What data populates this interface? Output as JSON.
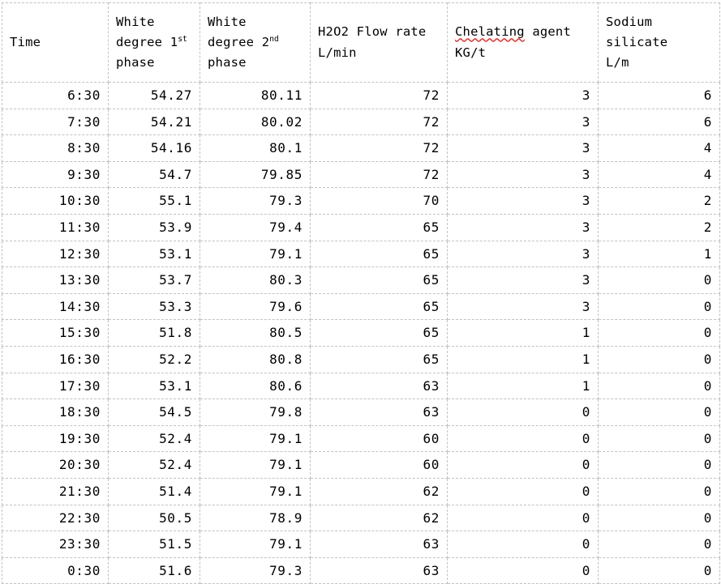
{
  "table": {
    "columns": [
      {
        "key": "time",
        "label": "Time",
        "label_lines": [
          "Time"
        ],
        "unit": ""
      },
      {
        "key": "wd1",
        "label": "White degree 1st phase",
        "label_lines": [
          "White",
          "degree 1st",
          "phase"
        ],
        "unit": ""
      },
      {
        "key": "wd2",
        "label": "White degree 2nd phase",
        "label_lines": [
          "White",
          "degree 2nd",
          "phase"
        ],
        "unit": ""
      },
      {
        "key": "h2o2",
        "label": "H2O2 Flow rate L/min",
        "label_lines": [
          "H2O2 Flow rate",
          "L/min"
        ],
        "unit": "L/min"
      },
      {
        "key": "chelating",
        "label": "Chelating agent KG/t",
        "label_lines": [
          "Chelating agent",
          "KG/t"
        ],
        "unit": "KG/t"
      },
      {
        "key": "silicate",
        "label": "Sodium silicate L/m",
        "label_lines": [
          "Sodium",
          "silicate",
          "L/m"
        ],
        "unit": "L/m"
      }
    ],
    "header": {
      "time": "Time",
      "white_degree_1st": {
        "line1": "White",
        "line2_pre": "degree 1",
        "line2_sup": "st",
        "line3": "phase"
      },
      "white_degree_2nd": {
        "line1": "White",
        "line2_pre": "degree 2",
        "line2_sup": "nd",
        "line3": "phase"
      },
      "h2o2": {
        "line1": "H2O2 Flow rate",
        "line2": "L/min"
      },
      "chelating": {
        "line1_misspelled": "Chelating",
        "line1_rest": " agent",
        "line2": "KG/t"
      },
      "sodium_silicate": {
        "line1": "Sodium",
        "line2": "silicate",
        "line3": "L/m"
      }
    },
    "rows": [
      {
        "time": "6:30",
        "wd1": "54.27",
        "wd2": "80.11",
        "h2o2": "72",
        "chelating": "3",
        "silicate": "6"
      },
      {
        "time": "7:30",
        "wd1": "54.21",
        "wd2": "80.02",
        "h2o2": "72",
        "chelating": "3",
        "silicate": "6"
      },
      {
        "time": "8:30",
        "wd1": "54.16",
        "wd2": "80.1",
        "h2o2": "72",
        "chelating": "3",
        "silicate": "4"
      },
      {
        "time": "9:30",
        "wd1": "54.7",
        "wd2": "79.85",
        "h2o2": "72",
        "chelating": "3",
        "silicate": "4"
      },
      {
        "time": "10:30",
        "wd1": "55.1",
        "wd2": "79.3",
        "h2o2": "70",
        "chelating": "3",
        "silicate": "2"
      },
      {
        "time": "11:30",
        "wd1": "53.9",
        "wd2": "79.4",
        "h2o2": "65",
        "chelating": "3",
        "silicate": "2"
      },
      {
        "time": "12:30",
        "wd1": "53.1",
        "wd2": "79.1",
        "h2o2": "65",
        "chelating": "3",
        "silicate": "1"
      },
      {
        "time": "13:30",
        "wd1": "53.7",
        "wd2": "80.3",
        "h2o2": "65",
        "chelating": "3",
        "silicate": "0"
      },
      {
        "time": "14:30",
        "wd1": "53.3",
        "wd2": "79.6",
        "h2o2": "65",
        "chelating": "3",
        "silicate": "0"
      },
      {
        "time": "15:30",
        "wd1": "51.8",
        "wd2": "80.5",
        "h2o2": "65",
        "chelating": "1",
        "silicate": "0"
      },
      {
        "time": "16:30",
        "wd1": "52.2",
        "wd2": "80.8",
        "h2o2": "65",
        "chelating": "1",
        "silicate": "0"
      },
      {
        "time": "17:30",
        "wd1": "53.1",
        "wd2": "80.6",
        "h2o2": "63",
        "chelating": "1",
        "silicate": "0"
      },
      {
        "time": "18:30",
        "wd1": "54.5",
        "wd2": "79.8",
        "h2o2": "63",
        "chelating": "0",
        "silicate": "0"
      },
      {
        "time": "19:30",
        "wd1": "52.4",
        "wd2": "79.1",
        "h2o2": "60",
        "chelating": "0",
        "silicate": "0"
      },
      {
        "time": "20:30",
        "wd1": "52.4",
        "wd2": "79.1",
        "h2o2": "60",
        "chelating": "0",
        "silicate": "0"
      },
      {
        "time": "21:30",
        "wd1": "51.4",
        "wd2": "79.1",
        "h2o2": "62",
        "chelating": "0",
        "silicate": "0"
      },
      {
        "time": "22:30",
        "wd1": "50.5",
        "wd2": "78.9",
        "h2o2": "62",
        "chelating": "0",
        "silicate": "0"
      },
      {
        "time": "23:30",
        "wd1": "51.5",
        "wd2": "79.1",
        "h2o2": "63",
        "chelating": "0",
        "silicate": "0"
      },
      {
        "time": "0:30",
        "wd1": "51.6",
        "wd2": "79.3",
        "h2o2": "63",
        "chelating": "0",
        "silicate": "0"
      }
    ]
  },
  "chart_data": {
    "type": "table",
    "title": "",
    "columns": [
      "Time",
      "White degree 1st phase",
      "White degree 2nd phase",
      "H2O2 Flow rate L/min",
      "Chelating agent KG/t",
      "Sodium silicate L/m"
    ],
    "x": [
      "6:30",
      "7:30",
      "8:30",
      "9:30",
      "10:30",
      "11:30",
      "12:30",
      "13:30",
      "14:30",
      "15:30",
      "16:30",
      "17:30",
      "18:30",
      "19:30",
      "20:30",
      "21:30",
      "22:30",
      "23:30",
      "0:30"
    ],
    "xlabel": "Time",
    "series": [
      {
        "name": "White degree 1st phase",
        "unit": "",
        "values": [
          54.27,
          54.21,
          54.16,
          54.7,
          55.1,
          53.9,
          53.1,
          53.7,
          53.3,
          51.8,
          52.2,
          53.1,
          54.5,
          52.4,
          52.4,
          51.4,
          50.5,
          51.5,
          51.6
        ]
      },
      {
        "name": "White degree 2nd phase",
        "unit": "",
        "values": [
          80.11,
          80.02,
          80.1,
          79.85,
          79.3,
          79.4,
          79.1,
          80.3,
          79.6,
          80.5,
          80.8,
          80.6,
          79.8,
          79.1,
          79.1,
          79.1,
          78.9,
          79.1,
          79.3
        ]
      },
      {
        "name": "H2O2 Flow rate",
        "unit": "L/min",
        "values": [
          72,
          72,
          72,
          72,
          70,
          65,
          65,
          65,
          65,
          65,
          65,
          63,
          63,
          60,
          60,
          62,
          62,
          63,
          63
        ]
      },
      {
        "name": "Chelating agent",
        "unit": "KG/t",
        "values": [
          3,
          3,
          3,
          3,
          3,
          3,
          3,
          3,
          3,
          1,
          1,
          1,
          0,
          0,
          0,
          0,
          0,
          0,
          0
        ]
      },
      {
        "name": "Sodium silicate",
        "unit": "L/m",
        "values": [
          6,
          6,
          4,
          4,
          2,
          2,
          1,
          0,
          0,
          0,
          0,
          0,
          0,
          0,
          0,
          0,
          0,
          0,
          0
        ]
      }
    ],
    "grid": true,
    "legend": "none"
  },
  "style": {
    "border_color": "#c2c2c2",
    "text_color": "#000000",
    "spellcheck_underline_color": "#e8322a",
    "background": "#ffffff"
  }
}
